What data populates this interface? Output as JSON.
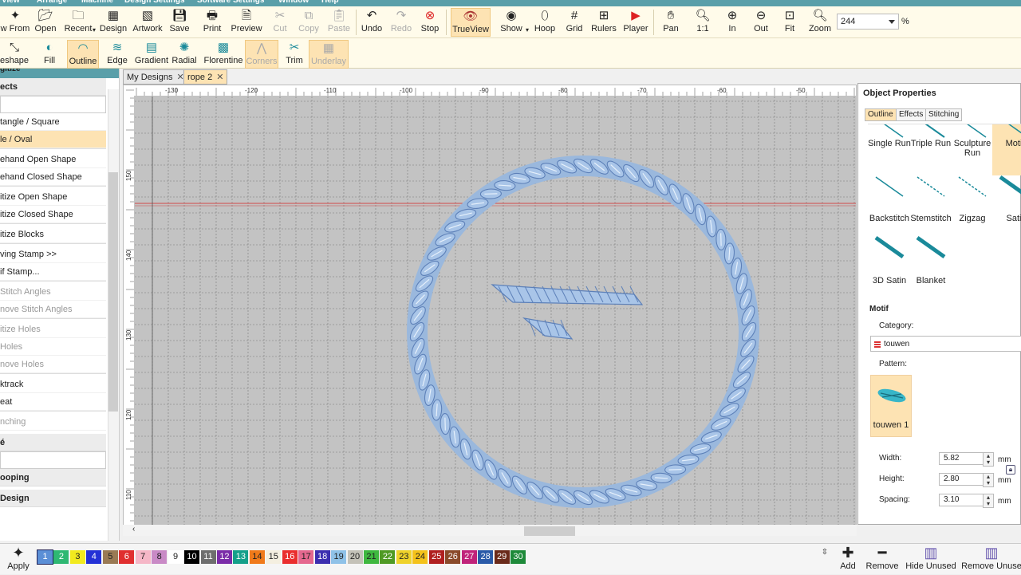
{
  "menu": [
    "View",
    "Arrange",
    "Machine",
    "Design Settings",
    "Software Settings",
    "Window",
    "Help"
  ],
  "toolbar1": [
    {
      "label": "w From",
      "icon": "new-from-icon"
    },
    {
      "label": "Open",
      "icon": "open-folder-icon"
    },
    {
      "label": "Recent",
      "icon": "recent-folder-icon"
    },
    {
      "label": "Design",
      "icon": "design-icon"
    },
    {
      "label": "Artwork",
      "icon": "artwork-icon"
    },
    {
      "label": "Save",
      "icon": "save-icon"
    },
    {
      "label": "Print",
      "icon": "print-icon"
    },
    {
      "label": "Preview",
      "icon": "preview-icon"
    },
    {
      "label": "Cut",
      "icon": "cut-icon"
    },
    {
      "label": "Copy",
      "icon": "copy-icon"
    },
    {
      "label": "Paste",
      "icon": "paste-icon"
    },
    {
      "label": "Undo",
      "icon": "undo-icon"
    },
    {
      "label": "Redo",
      "icon": "redo-icon"
    },
    {
      "label": "Stop",
      "icon": "stop-icon"
    },
    {
      "label": "TrueView",
      "icon": "trueview-icon"
    },
    {
      "label": "Show",
      "icon": "show-icon"
    },
    {
      "label": "Hoop",
      "icon": "hoop-icon"
    },
    {
      "label": "Grid",
      "icon": "grid-icon"
    },
    {
      "label": "Rulers",
      "icon": "rulers-icon"
    },
    {
      "label": "Player",
      "icon": "player-icon"
    },
    {
      "label": "Pan",
      "icon": "pan-hand-icon"
    },
    {
      "label": "1:1",
      "icon": "zoom-1to1-icon"
    },
    {
      "label": "In",
      "icon": "zoom-in-icon"
    },
    {
      "label": "Out",
      "icon": "zoom-out-icon"
    },
    {
      "label": "Fit",
      "icon": "zoom-fit-icon"
    },
    {
      "label": "Zoom",
      "icon": "zoom-icon"
    }
  ],
  "zoom": {
    "value": "244",
    "unit": "%"
  },
  "toolbar2": [
    {
      "label": "eshape",
      "icon": "reshape-icon"
    },
    {
      "label": "Fill",
      "icon": "fill-icon"
    },
    {
      "label": "Outline",
      "icon": "outline-icon"
    },
    {
      "label": "Edge",
      "icon": "edge-icon"
    },
    {
      "label": "Gradient",
      "icon": "gradient-icon"
    },
    {
      "label": "Radial",
      "icon": "radial-icon"
    },
    {
      "label": "Florentine",
      "icon": "florentine-icon"
    },
    {
      "label": "Corners",
      "icon": "corners-icon"
    },
    {
      "label": "Trim",
      "icon": "trim-icon"
    },
    {
      "label": "Underlay",
      "icon": "underlay-icon"
    }
  ],
  "leftpanel": {
    "head": "gitize",
    "objects_title": "ects",
    "items": [
      "tangle / Square",
      "le / Oval",
      "ehand Open Shape",
      "ehand Closed Shape",
      "itize Open Shape",
      "itize Closed Shape",
      "itize Blocks",
      "ving Stamp >>",
      "if Stamp...",
      "Stitch Angles",
      "nove Stitch Angles",
      "itize Holes",
      "Holes",
      "nove Holes",
      "ktrack",
      "eat",
      "nching"
    ],
    "s1": "é",
    "s2": "ooping",
    "s3": "Design"
  },
  "tabs": [
    {
      "label": "My Designs"
    },
    {
      "label": "rope 2"
    }
  ],
  "rulers": {
    "x": [
      "-130",
      "-120",
      "-110",
      "-100",
      "-90",
      "-80",
      "-70",
      "-60",
      "-50"
    ],
    "y": [
      "150",
      "140",
      "130",
      "120",
      "110"
    ]
  },
  "props": {
    "title": "Object Properties",
    "tabs": [
      "Outline",
      "Effects",
      "Stitching"
    ],
    "stitch_types": [
      "Single Run",
      "Triple Run",
      "Sculpture Run",
      "Moti",
      "Backstitch",
      "Stemstitch",
      "Zigzag",
      "Sati",
      "3D Satin",
      "Blanket"
    ],
    "motif_title": "Motif",
    "category_label": "Category:",
    "category_value": "touwen",
    "pattern_label": "Pattern:",
    "pattern_name": "touwen 1",
    "width_label": "Width:",
    "width_value": "5.82",
    "height_label": "Height:",
    "height_value": "2.80",
    "spacing_label": "Spacing:",
    "spacing_value": "3.10",
    "unit": "mm"
  },
  "bottom": {
    "apply": "Apply",
    "swatches": [
      {
        "n": "1",
        "c": "#5b8fd6"
      },
      {
        "n": "2",
        "c": "#2eb873"
      },
      {
        "n": "3",
        "c": "#f2ea1e"
      },
      {
        "n": "4",
        "c": "#2431d6"
      },
      {
        "n": "5",
        "c": "#9a7a54"
      },
      {
        "n": "6",
        "c": "#e02f2f"
      },
      {
        "n": "7",
        "c": "#f5b7c7"
      },
      {
        "n": "8",
        "c": "#c98ac6"
      },
      {
        "n": "9",
        "c": "#ffffff"
      },
      {
        "n": "10",
        "c": "#000000"
      },
      {
        "n": "11",
        "c": "#6e6e6e"
      },
      {
        "n": "12",
        "c": "#7b2ca8"
      },
      {
        "n": "13",
        "c": "#15a08a"
      },
      {
        "n": "14",
        "c": "#f07a1a"
      },
      {
        "n": "15",
        "c": "#f4efe0"
      },
      {
        "n": "16",
        "c": "#ea2e2e"
      },
      {
        "n": "17",
        "c": "#e5688f"
      },
      {
        "n": "18",
        "c": "#3c2fb0"
      },
      {
        "n": "19",
        "c": "#8fc2e8"
      },
      {
        "n": "20",
        "c": "#c4c2b8"
      },
      {
        "n": "21",
        "c": "#3fb83f"
      },
      {
        "n": "22",
        "c": "#4f9a24"
      },
      {
        "n": "23",
        "c": "#efd22a"
      },
      {
        "n": "24",
        "c": "#f4c21a"
      },
      {
        "n": "25",
        "c": "#b01f1f"
      },
      {
        "n": "26",
        "c": "#8a4a2a"
      },
      {
        "n": "27",
        "c": "#c0237a"
      },
      {
        "n": "28",
        "c": "#2a5aa8"
      },
      {
        "n": "29",
        "c": "#6a2a1a"
      },
      {
        "n": "30",
        "c": "#1e8a3a"
      }
    ],
    "add": "Add",
    "remove": "Remove",
    "hide_unused": "Hide Unused",
    "remove_unused": "Remove Unuse"
  }
}
